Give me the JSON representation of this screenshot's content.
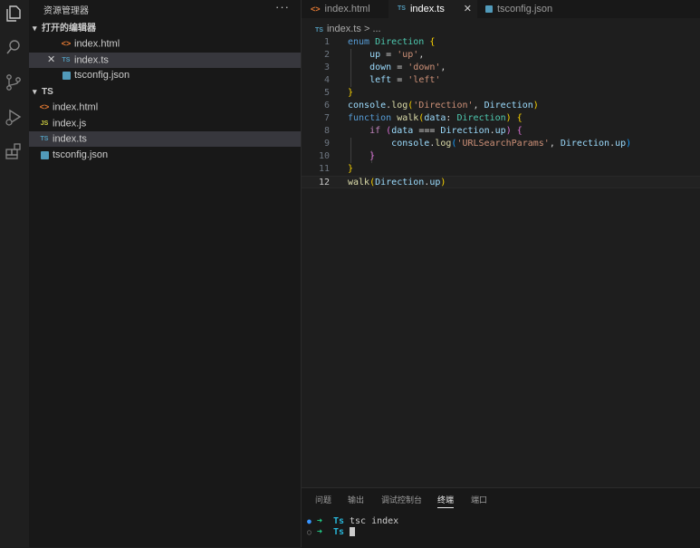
{
  "activity_bar": {
    "icons": [
      "files-icon",
      "search-icon",
      "source-control-icon",
      "run-debug-icon",
      "extensions-icon"
    ]
  },
  "sidebar": {
    "title": "资源管理器",
    "more": "···",
    "open_editors": {
      "label": "打开的编辑器",
      "items": [
        {
          "name": "index.html",
          "icon": "html-file-icon"
        },
        {
          "name": "index.ts",
          "icon": "ts-file-icon",
          "selected": true,
          "close": "✕"
        },
        {
          "name": "tsconfig.json",
          "icon": "json-file-icon"
        }
      ]
    },
    "folder": {
      "label": "TS",
      "items": [
        {
          "name": "index.html",
          "icon": "html-file-icon"
        },
        {
          "name": "index.js",
          "icon": "js-file-icon",
          "badge": "JS"
        },
        {
          "name": "index.ts",
          "icon": "ts-file-icon",
          "badge": "TS",
          "selected": true
        },
        {
          "name": "tsconfig.json",
          "icon": "json-file-icon"
        }
      ]
    }
  },
  "tabs": [
    {
      "label": "index.html",
      "icon": "html-file-icon"
    },
    {
      "label": "index.ts",
      "icon": "ts-file-icon",
      "badge": "TS",
      "active": true,
      "close": "✕"
    },
    {
      "label": "tsconfig.json",
      "icon": "json-file-icon"
    }
  ],
  "breadcrumb": {
    "badge": "TS",
    "file": "index.ts",
    "sep": ">",
    "rest": "..."
  },
  "code": {
    "current_line": 12,
    "line_numbers": [
      "1",
      "2",
      "3",
      "4",
      "5",
      "6",
      "7",
      "8",
      "9",
      "10",
      "11",
      "12"
    ]
  },
  "panel": {
    "tabs": [
      "问题",
      "输出",
      "调试控制台",
      "终端",
      "端口"
    ],
    "active_tab": "终端",
    "terminal": [
      {
        "dot": "●",
        "arrow": "➜",
        "dir": "Ts",
        "cmd": "tsc index"
      },
      {
        "dot": "○",
        "arrow": "➜",
        "dir": "Ts",
        "cmd": ""
      }
    ]
  },
  "colors": {
    "accent": "#3794ff",
    "keyword": "#569cd6",
    "string": "#ce9178",
    "type": "#4ec9b0"
  }
}
